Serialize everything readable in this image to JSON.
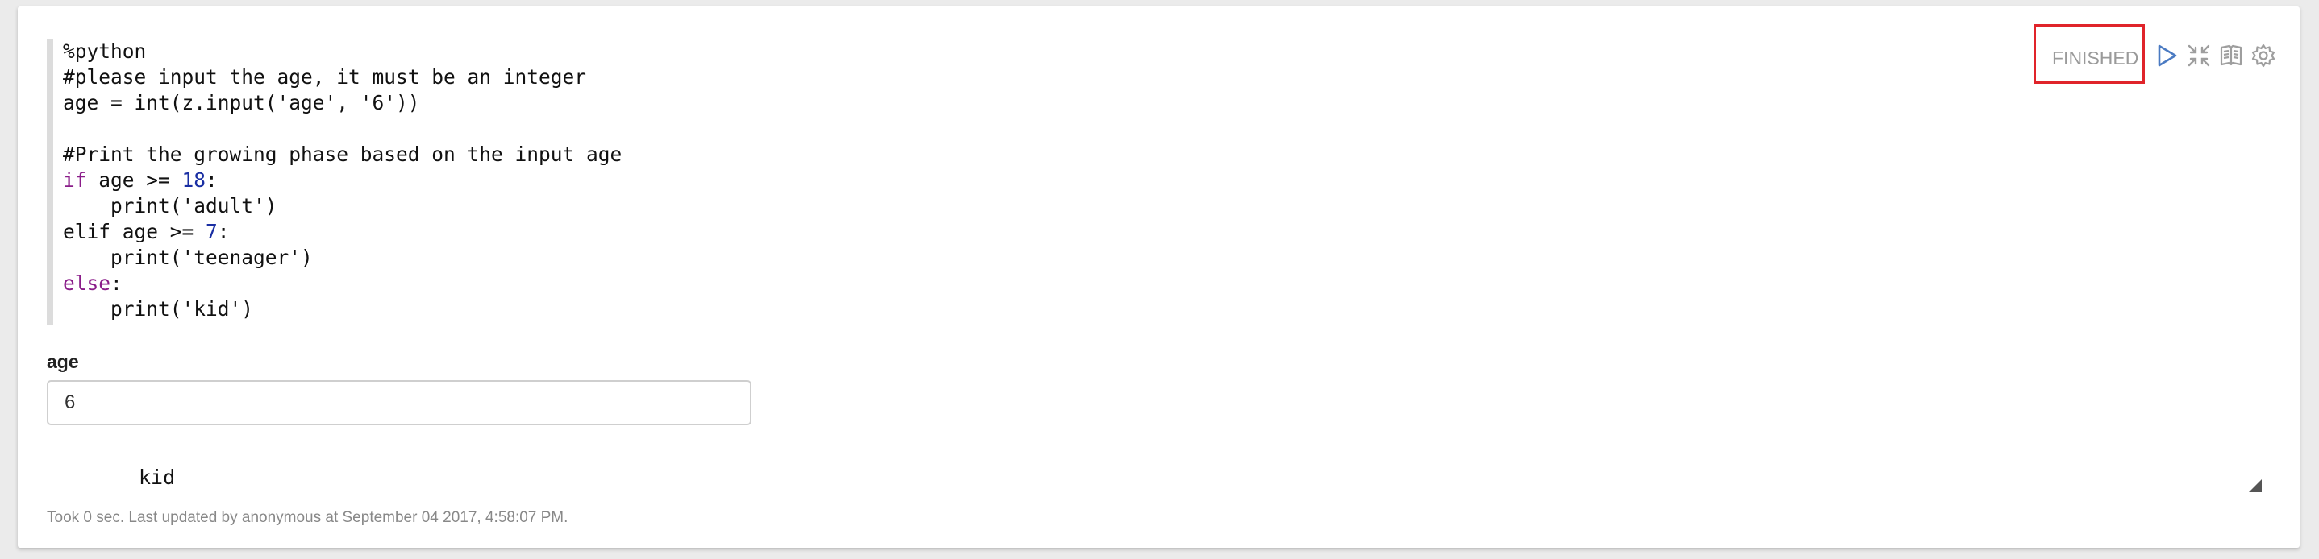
{
  "paragraph": {
    "code_lines": [
      [
        {
          "t": "%python",
          "c": ""
        }
      ],
      [
        {
          "t": "#please input the age, it must be an integer",
          "c": ""
        }
      ],
      [
        {
          "t": "age = int(z.input('age', '6'))",
          "c": ""
        }
      ],
      [
        {
          "t": "",
          "c": ""
        }
      ],
      [
        {
          "t": "#Print the growing phase based on the input age",
          "c": ""
        }
      ],
      [
        {
          "t": "if",
          "c": "kw"
        },
        {
          "t": " age >= ",
          "c": ""
        },
        {
          "t": "18",
          "c": "num"
        },
        {
          "t": ":",
          "c": ""
        }
      ],
      [
        {
          "t": "    print('adult')",
          "c": ""
        }
      ],
      [
        {
          "t": "elif age >= ",
          "c": ""
        },
        {
          "t": "7",
          "c": "num"
        },
        {
          "t": ":",
          "c": ""
        }
      ],
      [
        {
          "t": "    print('teenager')",
          "c": ""
        }
      ],
      [
        {
          "t": "else",
          "c": "kw"
        },
        {
          "t": ":",
          "c": ""
        }
      ],
      [
        {
          "t": "    print('kid')",
          "c": ""
        }
      ]
    ],
    "form": {
      "label": "age",
      "value": "6"
    },
    "result_text": "kid",
    "footer_text": "Took 0 sec. Last updated by anonymous at September 04 2017, 4:58:07 PM."
  },
  "controls": {
    "status": "FINISHED",
    "status_highlight_color": "#e0242a",
    "icons": [
      "run-play-icon",
      "collapse-arrows-icon",
      "book-open-icon",
      "gear-settings-icon"
    ]
  },
  "colors": {
    "keyword": "#8a1c89",
    "number": "#1a2fa3",
    "play_icon": "#4a7ac2"
  }
}
